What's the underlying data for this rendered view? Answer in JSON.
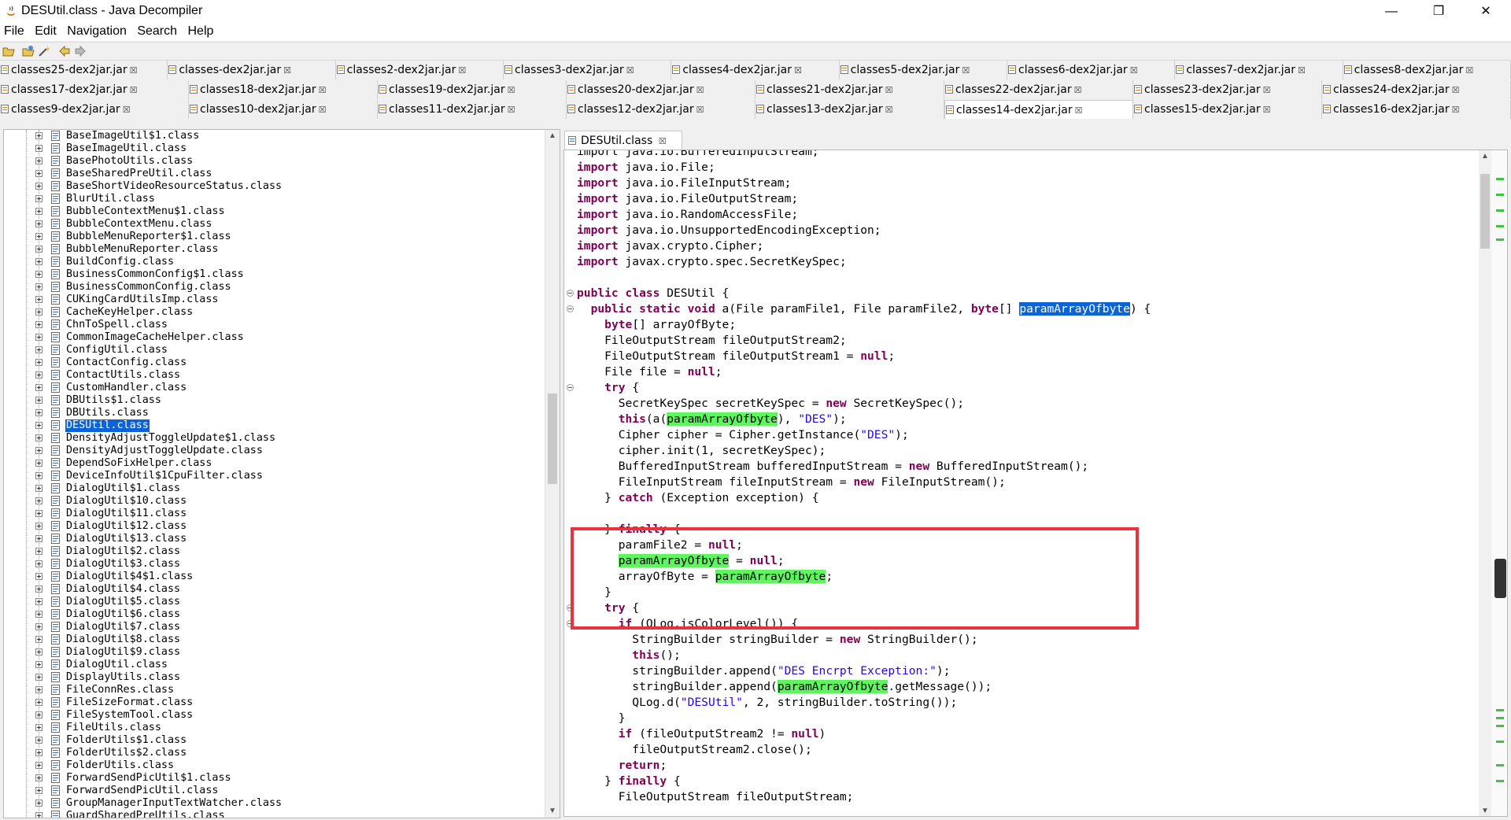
{
  "window": {
    "title": "DESUtil.class - Java Decompiler",
    "minimize": "—",
    "maximize": "❐",
    "close": "✕"
  },
  "menu": [
    "File",
    "Edit",
    "Navigation",
    "Search",
    "Help"
  ],
  "toolbar_icons": [
    "open-file-icon",
    "open-type-icon",
    "wand-icon",
    "back-arrow-icon",
    "forward-arrow-icon"
  ],
  "jar_tabs": [
    [
      "classes25-dex2jar.jar",
      "classes-dex2jar.jar",
      "classes2-dex2jar.jar",
      "classes3-dex2jar.jar",
      "classes4-dex2jar.jar",
      "classes5-dex2jar.jar",
      "classes6-dex2jar.jar",
      "classes7-dex2jar.jar",
      "classes8-dex2jar.jar"
    ],
    [
      "classes17-dex2jar.jar",
      "classes18-dex2jar.jar",
      "classes19-dex2jar.jar",
      "classes20-dex2jar.jar",
      "classes21-dex2jar.jar",
      "classes22-dex2jar.jar",
      "classes23-dex2jar.jar",
      "classes24-dex2jar.jar"
    ],
    [
      "classes9-dex2jar.jar",
      "classes10-dex2jar.jar",
      "classes11-dex2jar.jar",
      "classes12-dex2jar.jar",
      "classes13-dex2jar.jar",
      "classes14-dex2jar.jar",
      "classes15-dex2jar.jar",
      "classes16-dex2jar.jar"
    ]
  ],
  "active_jar_tab": "classes14-dex2jar.jar",
  "tab_close_glyph": "☒",
  "tree": {
    "selected": "DESUtil.class",
    "items": [
      "BaseImageUtil$1.class",
      "BaseImageUtil.class",
      "BasePhotoUtils.class",
      "BaseSharedPreUtil.class",
      "BaseShortVideoResourceStatus.class",
      "BlurUtil.class",
      "BubbleContextMenu$1.class",
      "BubbleContextMenu.class",
      "BubbleMenuReporter$1.class",
      "BubbleMenuReporter.class",
      "BuildConfig.class",
      "BusinessCommonConfig$1.class",
      "BusinessCommonConfig.class",
      "CUKingCardUtilsImp.class",
      "CacheKeyHelper.class",
      "ChnToSpell.class",
      "CommonImageCacheHelper.class",
      "ConfigUtil.class",
      "ContactConfig.class",
      "ContactUtils.class",
      "CustomHandler.class",
      "DBUtils$1.class",
      "DBUtils.class",
      "DESUtil.class",
      "DensityAdjustToggleUpdate$1.class",
      "DensityAdjustToggleUpdate.class",
      "DependSoFixHelper.class",
      "DeviceInfoUtil$1CpuFilter.class",
      "DialogUtil$1.class",
      "DialogUtil$10.class",
      "DialogUtil$11.class",
      "DialogUtil$12.class",
      "DialogUtil$13.class",
      "DialogUtil$2.class",
      "DialogUtil$3.class",
      "DialogUtil$4$1.class",
      "DialogUtil$4.class",
      "DialogUtil$5.class",
      "DialogUtil$6.class",
      "DialogUtil$7.class",
      "DialogUtil$8.class",
      "DialogUtil$9.class",
      "DialogUtil.class",
      "DisplayUtils.class",
      "FileConnRes.class",
      "FileSizeFormat.class",
      "FileSystemTool.class",
      "FileUtils.class",
      "FolderUtils$1.class",
      "FolderUtils$2.class",
      "FolderUtils.class",
      "ForwardSendPicUtil$1.class",
      "ForwardSendPicUtil.class",
      "GroupManagerInputTextWatcher.class",
      "GuardSharedPreUtils.class"
    ]
  },
  "editor": {
    "file_tab": "DESUtil.class",
    "lines": [
      [
        [
          "t",
          "import java.io.BufferedInputStream;"
        ]
      ],
      [
        [
          "k",
          "import"
        ],
        [
          "t",
          " java.io.File;"
        ]
      ],
      [
        [
          "k",
          "import"
        ],
        [
          "t",
          " java.io.FileInputStream;"
        ]
      ],
      [
        [
          "k",
          "import"
        ],
        [
          "t",
          " java.io.FileOutputStream;"
        ]
      ],
      [
        [
          "k",
          "import"
        ],
        [
          "t",
          " java.io.RandomAccessFile;"
        ]
      ],
      [
        [
          "k",
          "import"
        ],
        [
          "t",
          " java.io.UnsupportedEncodingException;"
        ]
      ],
      [
        [
          "k",
          "import"
        ],
        [
          "t",
          " javax.crypto.Cipher;"
        ]
      ],
      [
        [
          "k",
          "import"
        ],
        [
          "t",
          " javax.crypto.spec.SecretKeySpec;"
        ]
      ],
      [
        [
          "t",
          ""
        ]
      ],
      [
        [
          "k",
          "public class"
        ],
        [
          "t",
          " DESUtil {"
        ]
      ],
      [
        [
          "t",
          "  "
        ],
        [
          "k",
          "public static void"
        ],
        [
          "t",
          " a(File paramFile1, File paramFile2, "
        ],
        [
          "k",
          "byte"
        ],
        [
          "t",
          "[] "
        ],
        [
          "b",
          "paramArrayOfbyte"
        ],
        [
          "t",
          ") {"
        ]
      ],
      [
        [
          "t",
          "    "
        ],
        [
          "k",
          "byte"
        ],
        [
          "t",
          "[] arrayOfByte;"
        ]
      ],
      [
        [
          "t",
          "    FileOutputStream fileOutputStream2;"
        ]
      ],
      [
        [
          "t",
          "    FileOutputStream fileOutputStream1 = "
        ],
        [
          "k",
          "null"
        ],
        [
          "t",
          ";"
        ]
      ],
      [
        [
          "t",
          "    File file = "
        ],
        [
          "k",
          "null"
        ],
        [
          "t",
          ";"
        ]
      ],
      [
        [
          "t",
          "    "
        ],
        [
          "k",
          "try"
        ],
        [
          "t",
          " {"
        ]
      ],
      [
        [
          "t",
          "      SecretKeySpec secretKeySpec = "
        ],
        [
          "k",
          "new"
        ],
        [
          "t",
          " SecretKeySpec();"
        ]
      ],
      [
        [
          "t",
          "      "
        ],
        [
          "k",
          "this"
        ],
        [
          "t",
          "(a("
        ],
        [
          "g",
          "paramArrayOfbyte"
        ],
        [
          "t",
          "), "
        ],
        [
          "s",
          "\"DES\""
        ],
        [
          "t",
          ");"
        ]
      ],
      [
        [
          "t",
          "      Cipher cipher = Cipher.getInstance("
        ],
        [
          "s",
          "\"DES\""
        ],
        [
          "t",
          ");"
        ]
      ],
      [
        [
          "t",
          "      cipher.init(1, secretKeySpec);"
        ]
      ],
      [
        [
          "t",
          "      BufferedInputStream bufferedInputStream = "
        ],
        [
          "k",
          "new"
        ],
        [
          "t",
          " BufferedInputStream();"
        ]
      ],
      [
        [
          "t",
          "      FileInputStream fileInputStream = "
        ],
        [
          "k",
          "new"
        ],
        [
          "t",
          " FileInputStream();"
        ]
      ],
      [
        [
          "t",
          "    } "
        ],
        [
          "k",
          "catch"
        ],
        [
          "t",
          " (Exception exception) {"
        ]
      ],
      [
        [
          "t",
          ""
        ]
      ],
      [
        [
          "t",
          "    } "
        ],
        [
          "k",
          "finally"
        ],
        [
          "t",
          " {"
        ]
      ],
      [
        [
          "t",
          "      paramFile2 = "
        ],
        [
          "k",
          "null"
        ],
        [
          "t",
          ";"
        ]
      ],
      [
        [
          "t",
          "      "
        ],
        [
          "g",
          "paramArrayOfbyte"
        ],
        [
          "t",
          " = "
        ],
        [
          "k",
          "null"
        ],
        [
          "t",
          ";"
        ]
      ],
      [
        [
          "t",
          "      arrayOfByte = "
        ],
        [
          "g",
          "paramArrayOfbyte"
        ],
        [
          "t",
          ";"
        ]
      ],
      [
        [
          "t",
          "    }"
        ]
      ],
      [
        [
          "t",
          "    "
        ],
        [
          "k",
          "try"
        ],
        [
          "t",
          " {"
        ]
      ],
      [
        [
          "t",
          "      "
        ],
        [
          "k",
          "if"
        ],
        [
          "t",
          " (QLog.isColorLevel()) {"
        ]
      ],
      [
        [
          "t",
          "        StringBuilder stringBuilder = "
        ],
        [
          "k",
          "new"
        ],
        [
          "t",
          " StringBuilder();"
        ]
      ],
      [
        [
          "t",
          "        "
        ],
        [
          "k",
          "this"
        ],
        [
          "t",
          "();"
        ]
      ],
      [
        [
          "t",
          "        stringBuilder.append("
        ],
        [
          "s",
          "\"DES Encrpt Exception:\""
        ],
        [
          "t",
          ");"
        ]
      ],
      [
        [
          "t",
          "        stringBuilder.append("
        ],
        [
          "g",
          "paramArrayOfbyte"
        ],
        [
          "t",
          ".getMessage());"
        ]
      ],
      [
        [
          "t",
          "        QLog.d("
        ],
        [
          "s",
          "\"DESUtil\""
        ],
        [
          "t",
          ", 2, stringBuilder.toString());"
        ]
      ],
      [
        [
          "t",
          "      }"
        ]
      ],
      [
        [
          "t",
          "      "
        ],
        [
          "k",
          "if"
        ],
        [
          "t",
          " (fileOutputStream2 != "
        ],
        [
          "k",
          "null"
        ],
        [
          "t",
          ")"
        ]
      ],
      [
        [
          "t",
          "        fileOutputStream2.close();"
        ]
      ],
      [
        [
          "t",
          "      "
        ],
        [
          "k",
          "return"
        ],
        [
          "t",
          ";"
        ]
      ],
      [
        [
          "t",
          "    } "
        ],
        [
          "k",
          "finally"
        ],
        [
          "t",
          " {"
        ]
      ],
      [
        [
          "t",
          "      FileOutputStream fileOutputStream;"
        ]
      ]
    ]
  }
}
